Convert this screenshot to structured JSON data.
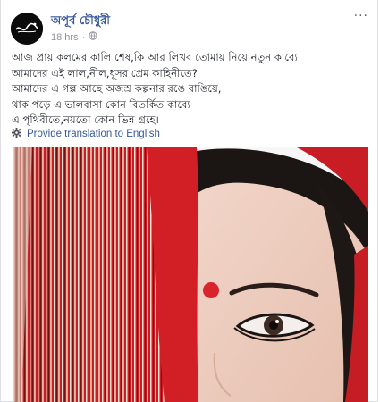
{
  "post": {
    "author": "অপূর্ব চৌধুরী",
    "time": "18 hrs",
    "more_label": "···",
    "lines": [
      "আজ প্রায় কলমের কালি শেষ,কি আর লিখব তোমায় নিয়ে নতুন কাব্যে",
      "আমাদের এই লাল,নীল,ধূসর প্রেম কাহিনীতে?",
      "আমাদের এ গল্প আছে অজস্র কল্পনার রঙে রাঙিয়ে,",
      "থাক পড়ে এ ভালবাসা কোন বিতর্কিত কাব্যে",
      "এ পৃথিবীতে,নয়তো কোন ভিন্ন গ্রহে।"
    ],
    "translate_label": "Provide translation to English",
    "avatar_text": "অপূর্ব চৌধুরী"
  },
  "colors": {
    "author": "#365899",
    "meta": "#90949c",
    "text": "#1d2129",
    "scarf_red": "#d21f26",
    "bindi": "#d8242a"
  },
  "icons": {
    "audience": "globe-icon",
    "translate": "gear-icon",
    "menu": "more-options-icon"
  }
}
